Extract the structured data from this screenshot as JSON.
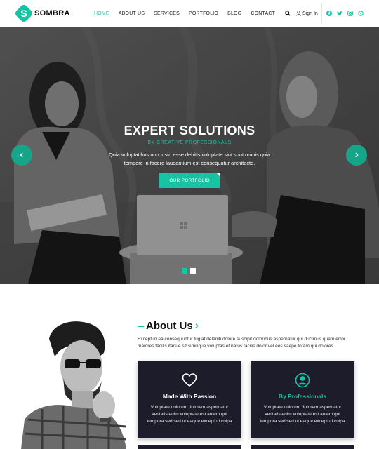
{
  "brand": {
    "name": "SOMBRA",
    "mark": "S",
    "accent": "#17c3a3"
  },
  "nav": {
    "items": [
      {
        "label": "HOME",
        "active": true
      },
      {
        "label": "ABOUT US",
        "active": false
      },
      {
        "label": "SERVICES",
        "active": false
      },
      {
        "label": "PORTFOLIO",
        "active": false
      },
      {
        "label": "BLOG",
        "active": false
      },
      {
        "label": "CONTACT",
        "active": false
      }
    ],
    "signin_label": "Sign In",
    "social_icons": [
      "facebook-icon",
      "twitter-icon",
      "instagram-icon",
      "whatsapp-icon"
    ]
  },
  "hero": {
    "title": "EXPERT SOLUTIONS",
    "subtitle": "BY CREATIVE PROFESSIONALS",
    "text": "Quia voluptatibus non iusto esse debitis voluptate sint sunt omnis quia tempore in facere laudantium est consequatur architecto.",
    "button_label": "OUR PORTFOLIO",
    "slide_count": 2,
    "active_slide": 1
  },
  "about": {
    "title": "About Us",
    "text": "Excepturi ea consequuntur fugiat deleniti dolore suscipit doloribus aspernatur qui ducimus quam error maiores facilis itaque sit similique voluptas et natus facilis dolor vel eos saepe totam qui dolores.",
    "cards": [
      {
        "icon": "heart-icon",
        "title": "Made With Passion",
        "text": "Voluptate dolorum dolorem aspernatur veritatis enim voluptate est autem qui tempora sed sed ut eaque excepturi culpa"
      },
      {
        "icon": "user-circle-icon",
        "title": "By Professionals",
        "text": "Voluptate dolorum dolorem aspernatur veritatis enim voluptate est autem qui tempora sed sed ut eaque excepturi culpa"
      }
    ]
  }
}
